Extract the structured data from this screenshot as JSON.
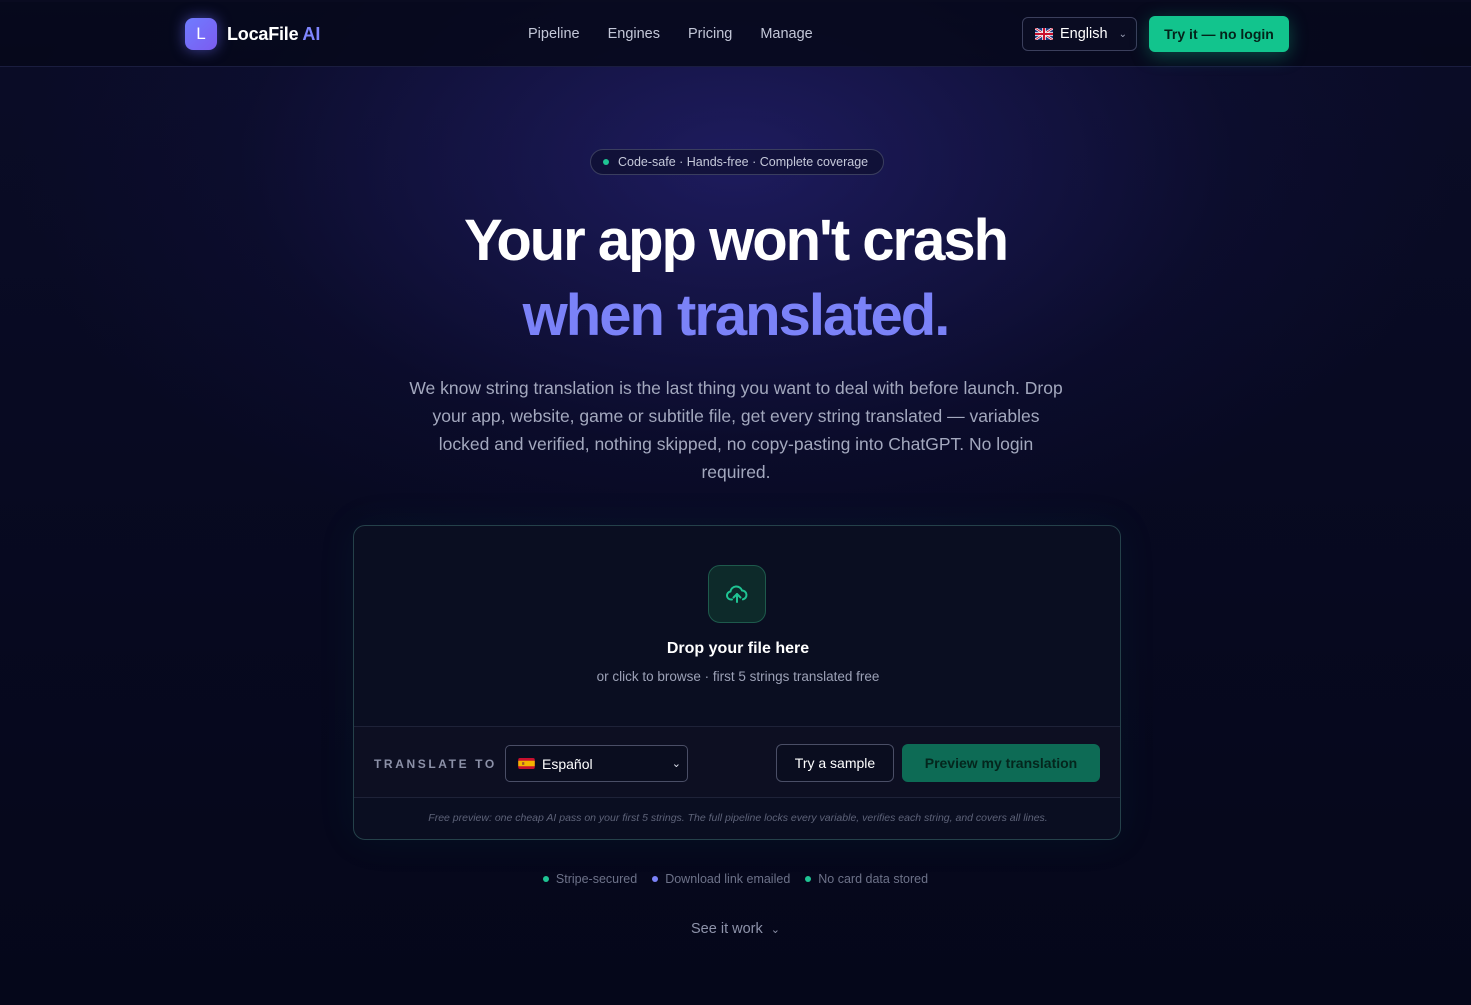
{
  "nav": {
    "brand_name": "LocaFile",
    "brand_suffix": "AI",
    "logo_letter": "L",
    "links": [
      "Pipeline",
      "Engines",
      "Pricing",
      "Manage"
    ],
    "language": "English",
    "language_flag": "uk-flag-icon",
    "cta": "Try it — no login"
  },
  "hero": {
    "badge": "Code-safe · Hands-free · Complete coverage",
    "headline_line1": "Your app won't crash",
    "headline_line2": "when translated.",
    "lead": "We know string translation is the last thing you want to deal with before launch. Drop your app, website, game or subtitle file, get every string translated — variables locked and verified, nothing skipped, no copy-pasting into ChatGPT. No login required."
  },
  "upload": {
    "icon": "upload-cloud-icon",
    "title": "Drop your file here",
    "subtitle": "or click to browse · first 5 strings translated free",
    "translate_label": "TRANSLATE TO",
    "selected_language": "Español",
    "selected_flag": "es-flag-icon",
    "sample_button": "Try a sample",
    "preview_button": "Preview my translation",
    "fine_print": "Free preview: one cheap AI pass on your first 5 strings. The full pipeline locks every variable, verifies each string, and covers all lines."
  },
  "trust": [
    {
      "label": "Stripe-secured",
      "color": "#1fc493"
    },
    {
      "label": "Download link emailed",
      "color": "#7b82f8"
    },
    {
      "label": "No card data stored",
      "color": "#1fc493"
    }
  ],
  "see_it_work": "See it work",
  "colors": {
    "accent_green": "#12c48d",
    "accent_purple": "#7b82f8",
    "background": "#05071a"
  }
}
